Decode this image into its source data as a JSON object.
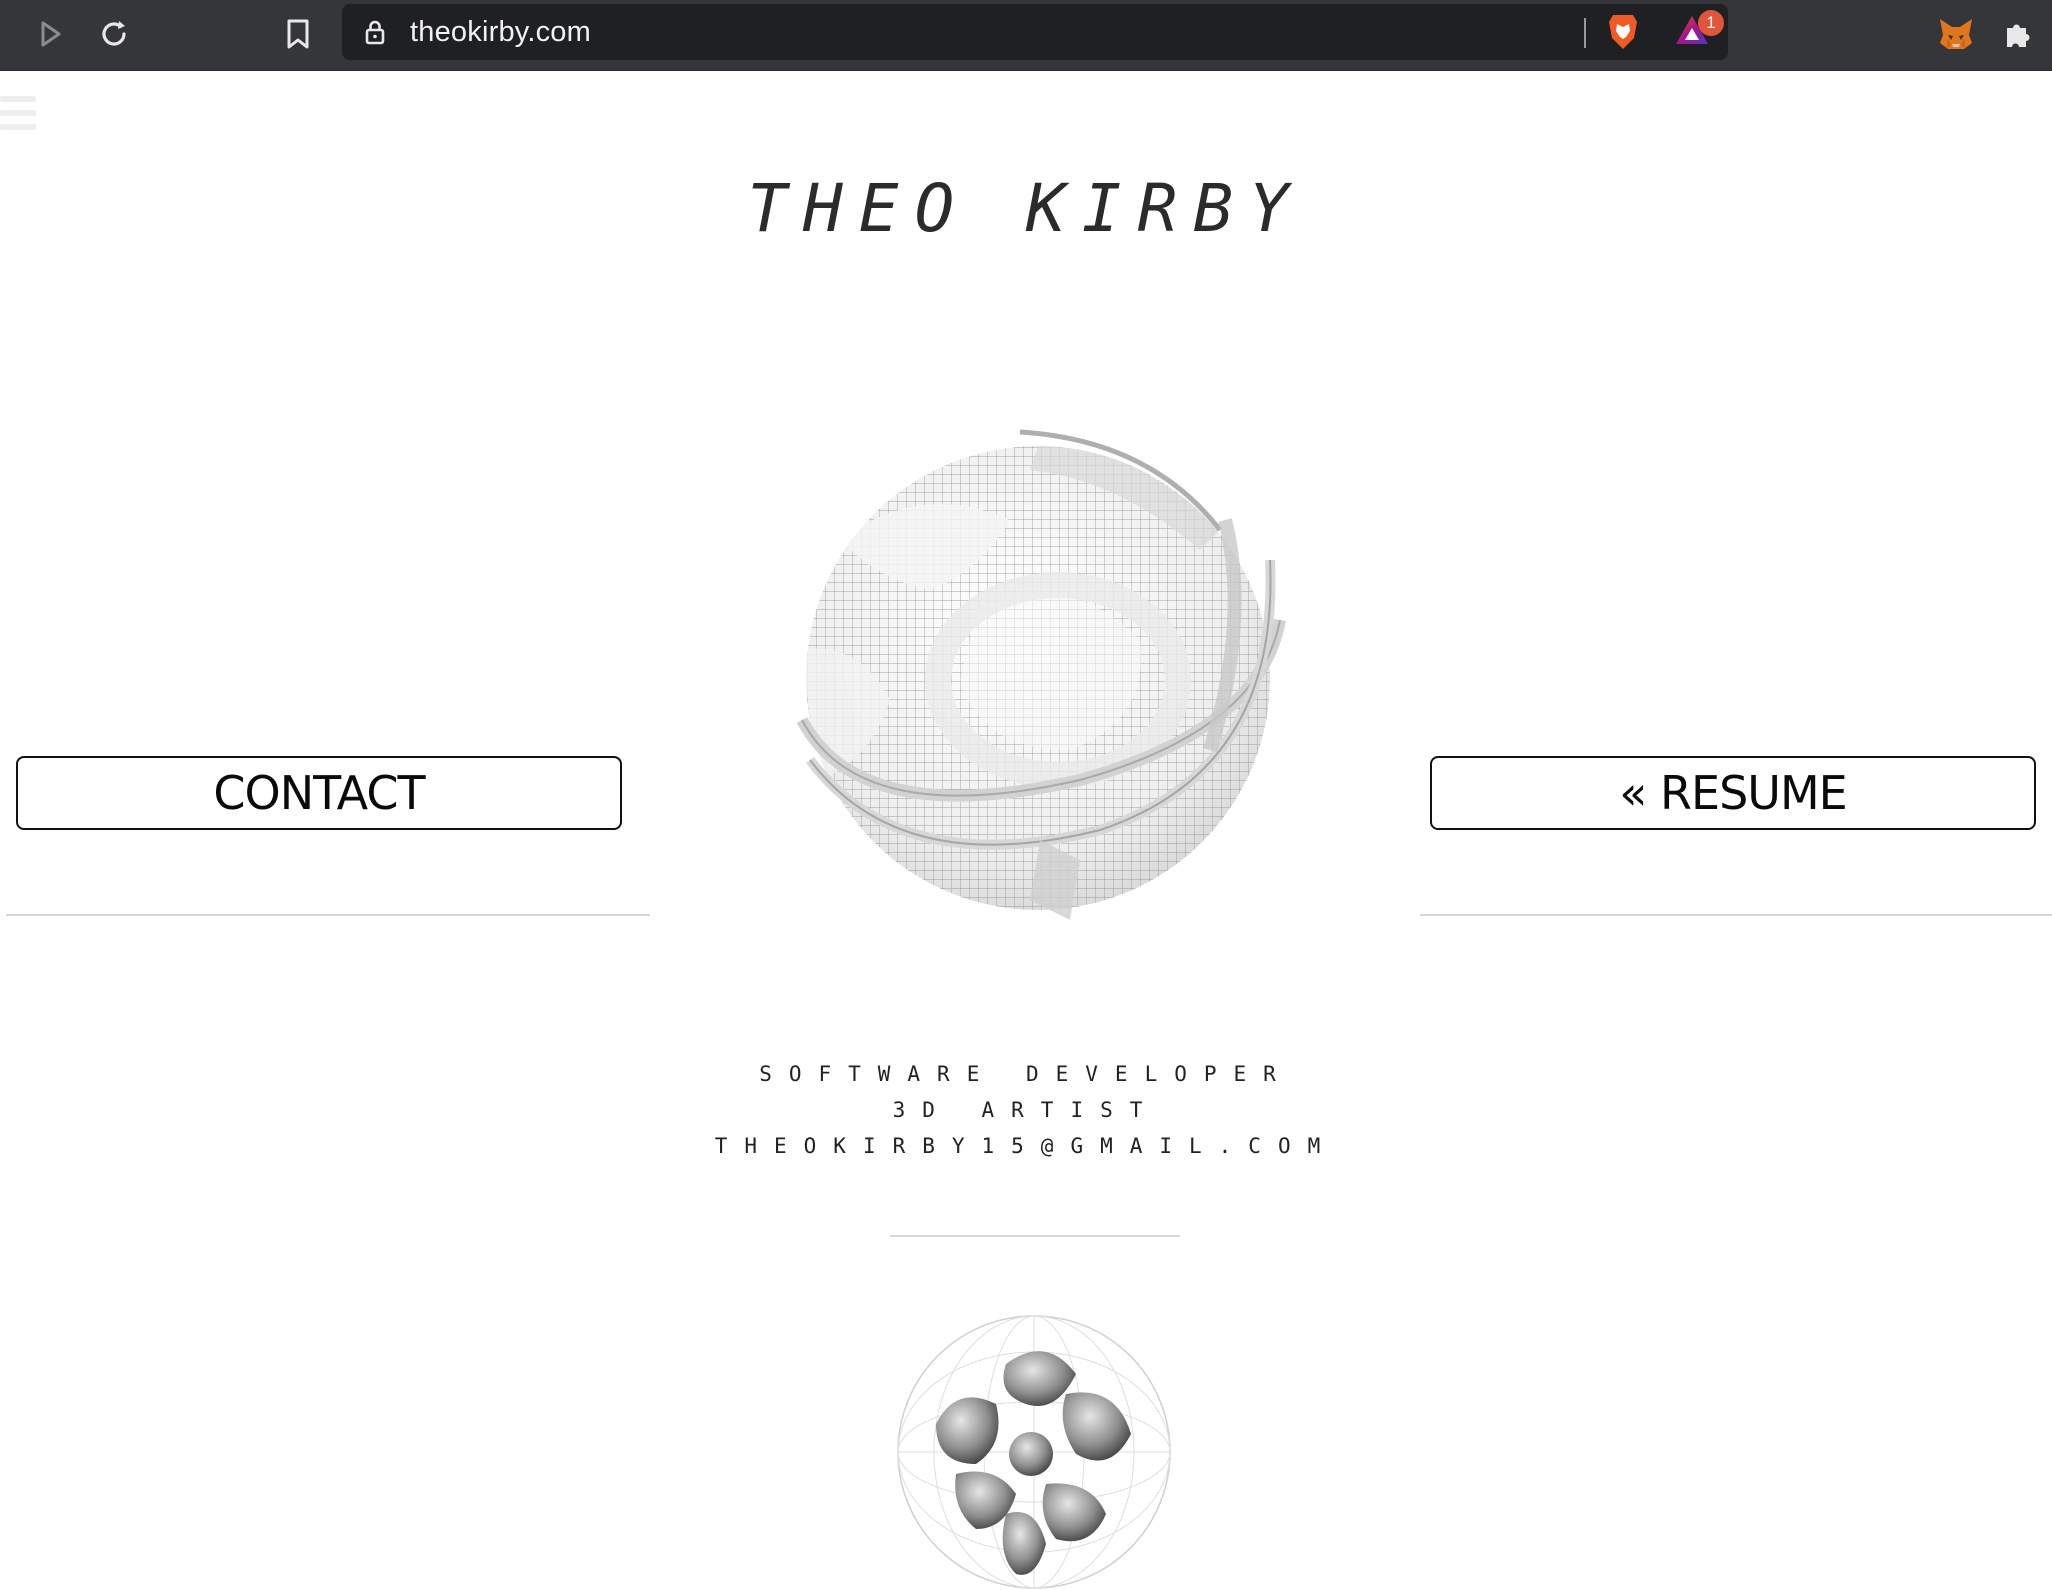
{
  "browser": {
    "url": "theokirby.com",
    "rewards_badge": "1",
    "icons": [
      "play-icon",
      "reload-icon",
      "bookmark-icon",
      "lock-icon",
      "brave-shields-icon",
      "brave-rewards-icon",
      "metamask-icon",
      "extensions-icon"
    ]
  },
  "page": {
    "title": "THEO KIRBY",
    "contact_label": "CONTACT",
    "resume_label": "« RESUME",
    "info_lines": [
      "SOFTWARE DEVELOPER",
      "3D ARTIST",
      "THEOKIRBY15@GMAIL.COM"
    ]
  },
  "colors": {
    "chrome_bg": "#35363a",
    "urlbar_bg": "#1f2023",
    "badge": "#e2553d",
    "text": "#2b2b2b",
    "divider": "#d6d6d6"
  }
}
